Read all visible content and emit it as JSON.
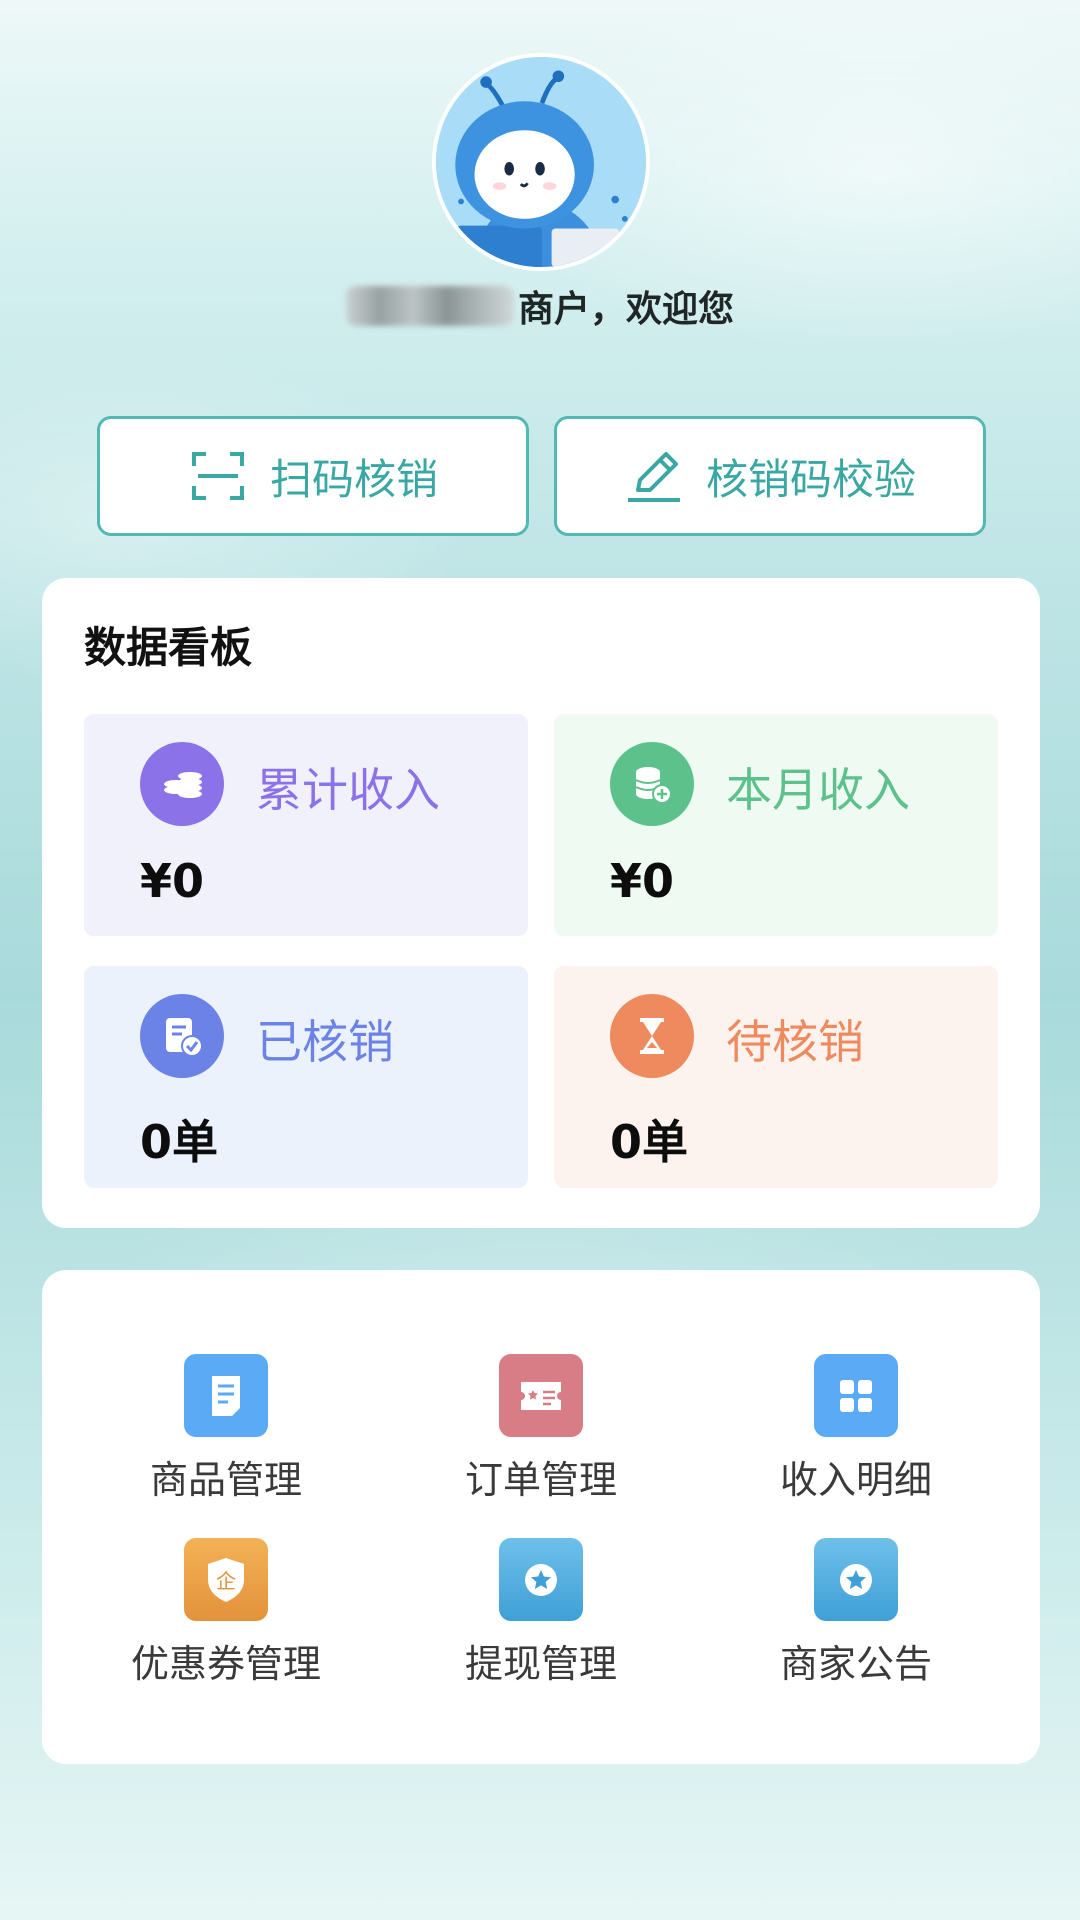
{
  "header": {
    "avatar_icon": "mascot-avatar",
    "welcome_suffix": "商户，欢迎您"
  },
  "actions": {
    "scan_label": "扫码核销",
    "scan_icon": "scan-icon",
    "verify_label": "核销码校验",
    "verify_icon": "pencil-icon"
  },
  "dashboard": {
    "title": "数据看板",
    "tiles": [
      {
        "label": "累计收入",
        "value": "¥0",
        "icon": "coins-icon",
        "color": "#8b72e8",
        "bg": "#f1f1fc"
      },
      {
        "label": "本月收入",
        "value": "¥0",
        "icon": "coin-stack-icon",
        "color": "#5cc18a",
        "bg": "#eefaf2"
      },
      {
        "label": "已核销",
        "value": "0单",
        "icon": "verified-doc-icon",
        "color": "#6b83e6",
        "bg": "#ebf2fc"
      },
      {
        "label": "待核销",
        "value": "0单",
        "icon": "hourglass-icon",
        "color": "#ef8a5e",
        "bg": "#fdf3ee"
      }
    ]
  },
  "menu": {
    "items": [
      {
        "label": "商品管理",
        "icon": "document-icon",
        "color": "#5aaaf5"
      },
      {
        "label": "订单管理",
        "icon": "ticket-icon",
        "color": "#d87c86"
      },
      {
        "label": "收入明细",
        "icon": "grid-icon",
        "color": "#5aaaf5"
      },
      {
        "label": "优惠券管理",
        "icon": "enterprise-badge-icon",
        "color": "#eba14a"
      },
      {
        "label": "提现管理",
        "icon": "star-badge-icon",
        "color": "#52acdc"
      },
      {
        "label": "商家公告",
        "icon": "star-badge-icon",
        "color": "#52acdc"
      }
    ]
  }
}
